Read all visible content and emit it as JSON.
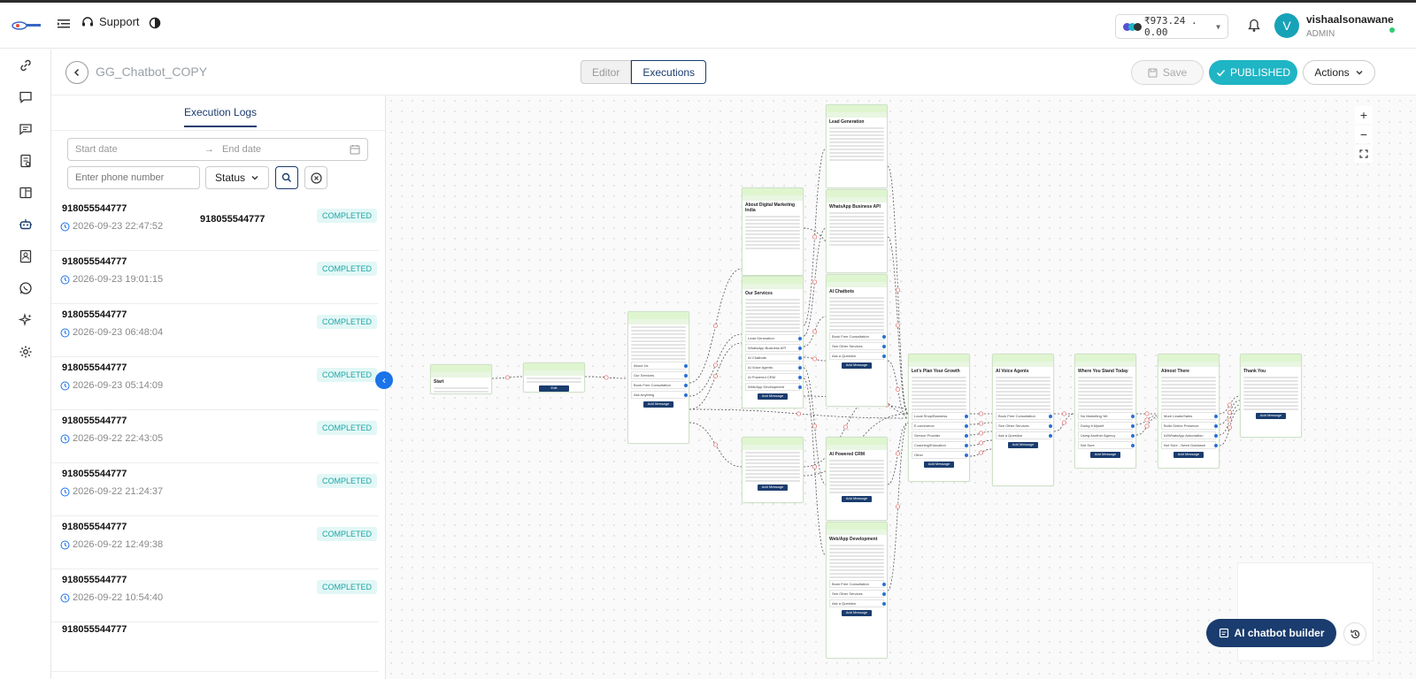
{
  "header": {
    "support_label": "Support",
    "wallet_balance": "₹973.24 . 0.00",
    "user_name": "vishaalsonawane",
    "user_role": "ADMIN",
    "avatar_initial": "V"
  },
  "titlebar": {
    "bot_title": "GG_Chatbot_COPY",
    "tab_editor": "Editor",
    "tab_executions": "Executions",
    "save_label": "Save",
    "published_label": "PUBLISHED",
    "actions_label": "Actions"
  },
  "panel": {
    "tab_label": "Execution Logs",
    "start_date_placeholder": "Start date",
    "end_date_placeholder": "End date",
    "phone_placeholder": "Enter phone number",
    "status_label": "Status"
  },
  "logs": [
    {
      "number": "918055544777",
      "timestamp": "2026-09-23 22:47:52",
      "status": "COMPLETED",
      "extra": "918055544777"
    },
    {
      "number": "918055544777",
      "timestamp": "2026-09-23 19:01:15",
      "status": "COMPLETED"
    },
    {
      "number": "918055544777",
      "timestamp": "2026-09-23 06:48:04",
      "status": "COMPLETED"
    },
    {
      "number": "918055544777",
      "timestamp": "2026-09-23 05:14:09",
      "status": "COMPLETED"
    },
    {
      "number": "918055544777",
      "timestamp": "2026-09-22 22:43:05",
      "status": "COMPLETED"
    },
    {
      "number": "918055544777",
      "timestamp": "2026-09-22 21:24:37",
      "status": "COMPLETED"
    },
    {
      "number": "918055544777",
      "timestamp": "2026-09-22 12:49:38",
      "status": "COMPLETED"
    },
    {
      "number": "918055544777",
      "timestamp": "2026-09-22 10:54:40",
      "status": "COMPLETED"
    },
    {
      "number": "918055544777",
      "timestamp": "",
      "status": ""
    }
  ],
  "canvas": {
    "ai_builder_label": "AI chatbot builder",
    "nodes": [
      {
        "title": "Start",
        "options": [],
        "add": ""
      },
      {
        "title": "",
        "options": [],
        "add": "Edit"
      },
      {
        "title": "",
        "options": [
          "About Us",
          "Our Services",
          "Book Free Consultation",
          "Ask Anything"
        ],
        "add": "Add Message"
      },
      {
        "title": "About Digital Marketing India",
        "options": [],
        "add": ""
      },
      {
        "title": "Our Services",
        "options": [
          "Lead Generation",
          "WhatsApp Business API",
          "AI Chatbots",
          "AI Voice Agents",
          "AI Powered CRM",
          "Web/App Development"
        ],
        "add": "Add Message"
      },
      {
        "title": "Lead Generation",
        "options": [],
        "add": ""
      },
      {
        "title": "WhatsApp Business API",
        "options": [],
        "add": ""
      },
      {
        "title": "AI Chatbots",
        "options": [
          "Book Free Consultation",
          "See Other Services",
          "Ask a Question"
        ],
        "add": "Add Message"
      },
      {
        "title": "",
        "options": [],
        "add": "Add Message"
      },
      {
        "title": "AI Powered CRM",
        "options": [],
        "add": "Add Message"
      },
      {
        "title": "Web/App Development",
        "options": [
          "Book Free Consultation",
          "See Other Services",
          "Ask a Question"
        ],
        "add": "Add Message"
      },
      {
        "title": "Let's Plan Your Growth",
        "options": [
          "Local Shop/Business",
          "E-commerce",
          "Service Provider",
          "Coaching/Education",
          "Other"
        ],
        "add": "Add Message"
      },
      {
        "title": "AI Voice Agents",
        "options": [
          "Book Free Consultation",
          "See Other Services",
          "Ask a Question"
        ],
        "add": "Add Message"
      },
      {
        "title": "Where You Stand Today",
        "options": [
          "No Marketing Yet",
          "Doing it Myself",
          "Using Another Agency",
          "Not Sure"
        ],
        "add": "Add Message"
      },
      {
        "title": "Almost There",
        "options": [
          "More Leads/Sales",
          "Build Online Presence",
          "AI/WhatsApp Automation",
          "Not Sure - Need Guidance"
        ],
        "add": "Add Message"
      },
      {
        "title": "Thank You",
        "options": [],
        "add": "Add Message"
      }
    ]
  },
  "colors": {
    "accent": "#1fb5c4",
    "navy": "#1a3c6e",
    "completed_text": "#1ea6a6",
    "completed_bg": "#e2f7f6",
    "node_header": "#dff5d0"
  }
}
